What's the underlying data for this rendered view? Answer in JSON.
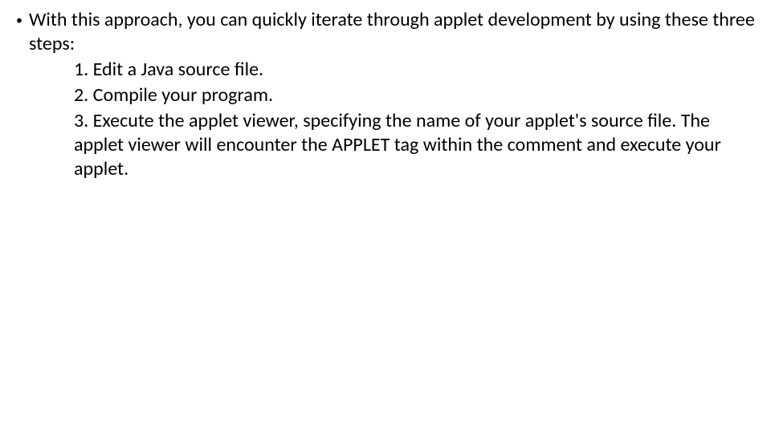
{
  "bullet": "•",
  "intro": "With this approach, you can quickly iterate through applet development by using these three steps:",
  "steps": [
    "1. Edit a Java source file.",
    "2. Compile your program.",
    "3. Execute the applet viewer, specifying the name of your applet's source file. The applet viewer will encounter the APPLET tag within the comment and execute your applet."
  ]
}
